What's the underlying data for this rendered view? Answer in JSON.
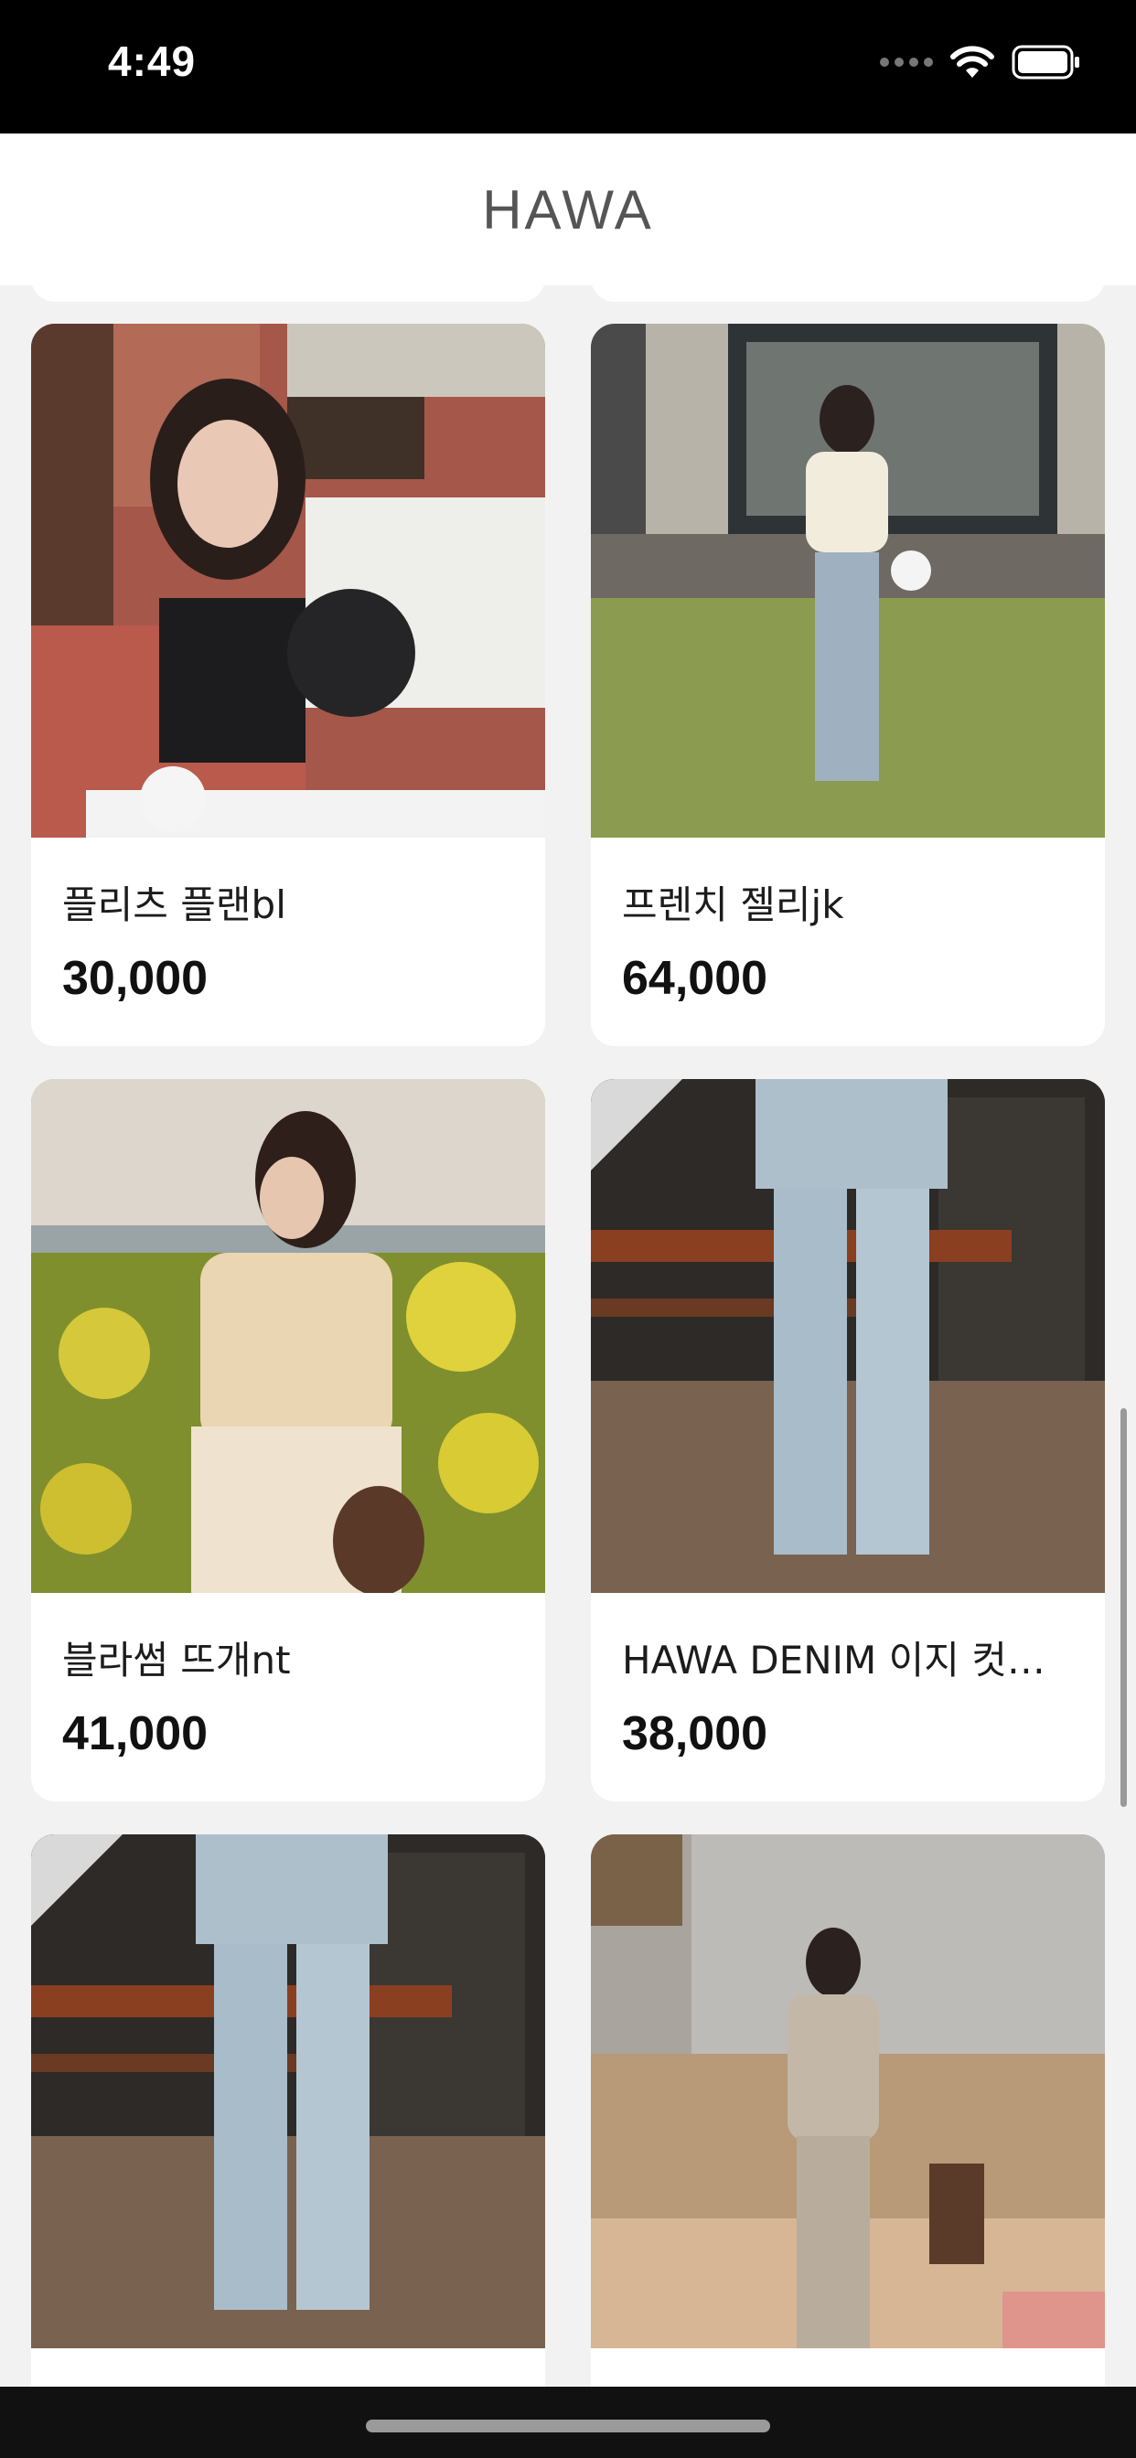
{
  "status_bar": {
    "time": "4:49"
  },
  "header": {
    "title": "HAWA"
  },
  "products": [
    {
      "name": "플리츠 플랜bl",
      "price": "30,000"
    },
    {
      "name": "프렌치 젤리jk",
      "price": "64,000"
    },
    {
      "name": "블라썸 뜨개nt",
      "price": "41,000"
    },
    {
      "name": "HAWA DENIM 이지 컷…",
      "price": "38,000"
    }
  ],
  "colors": {
    "status_bar_bg": "#000000",
    "page_bg": "#f2f2f2",
    "card_bg": "#ffffff",
    "price_text": "#111111"
  },
  "icons": [
    "wifi-icon",
    "battery-icon",
    "cellular-dots-icon"
  ]
}
